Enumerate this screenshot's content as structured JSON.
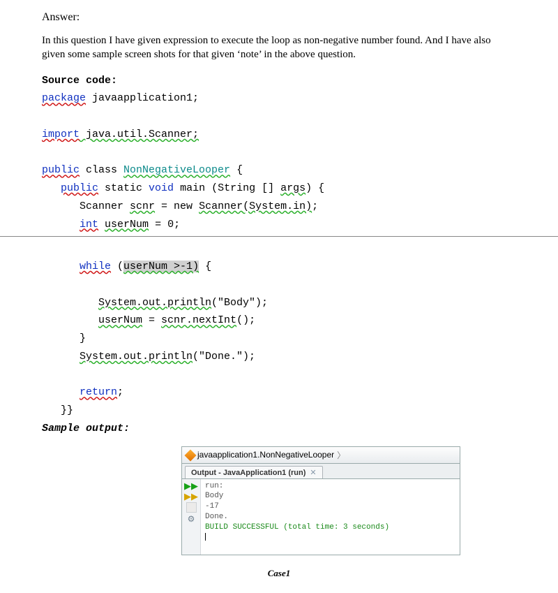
{
  "answer_label": "Answer:",
  "intro": "In this question I have given expression to execute the loop as non-negative number found. And I have also given some sample screen shots for that given ‘note’ in the above question.",
  "source_label": "Source code:",
  "code": {
    "l1_pre": "package",
    "l1_post": " javaapplication1;",
    "l2_pre": "import",
    "l2_post": " java.util.Scanner;",
    "l3a": "public",
    "l3b": " class ",
    "l3c": "NonNegativeLooper",
    "l3d": " {",
    "l4a": "public",
    "l4b": " static ",
    "l4c": "void",
    "l4d": " main (String [] ",
    "l4e": "args",
    "l4f": ") {",
    "l5": "Scanner ",
    "l5b": "scnr",
    "l5c": " = new ",
    "l5d": "Scanner(System.in)",
    "l5e": ";",
    "l6a": "int",
    "l6b": " ",
    "l6c": "userNum",
    "l6d": " = 0;",
    "l7a": "while",
    "l7b": " (",
    "l7c": "userNum >-1)",
    "l7d": " {",
    "l8": "System.out.println",
    "l8b": "(\"Body\");",
    "l9a": "userNum",
    "l9b": " = ",
    "l9c": "scnr.nextInt",
    "l9d": "();",
    "l10": "}",
    "l11": "System.out.println",
    "l11b": "(\"Done.\");",
    "l12": "return",
    "l12b": ";",
    "l13": "}}"
  },
  "sample_label": "Sample output:",
  "output": {
    "breadcrumb": "javaapplication1.NonNegativeLooper",
    "tab": "Output - JavaApplication1 (run)",
    "lines": {
      "run": "run:",
      "body": "Body",
      "neg": "-17",
      "done": "Done.",
      "build": "BUILD SUCCESSFUL (total time: 3 seconds)"
    }
  },
  "caption": "Case1"
}
